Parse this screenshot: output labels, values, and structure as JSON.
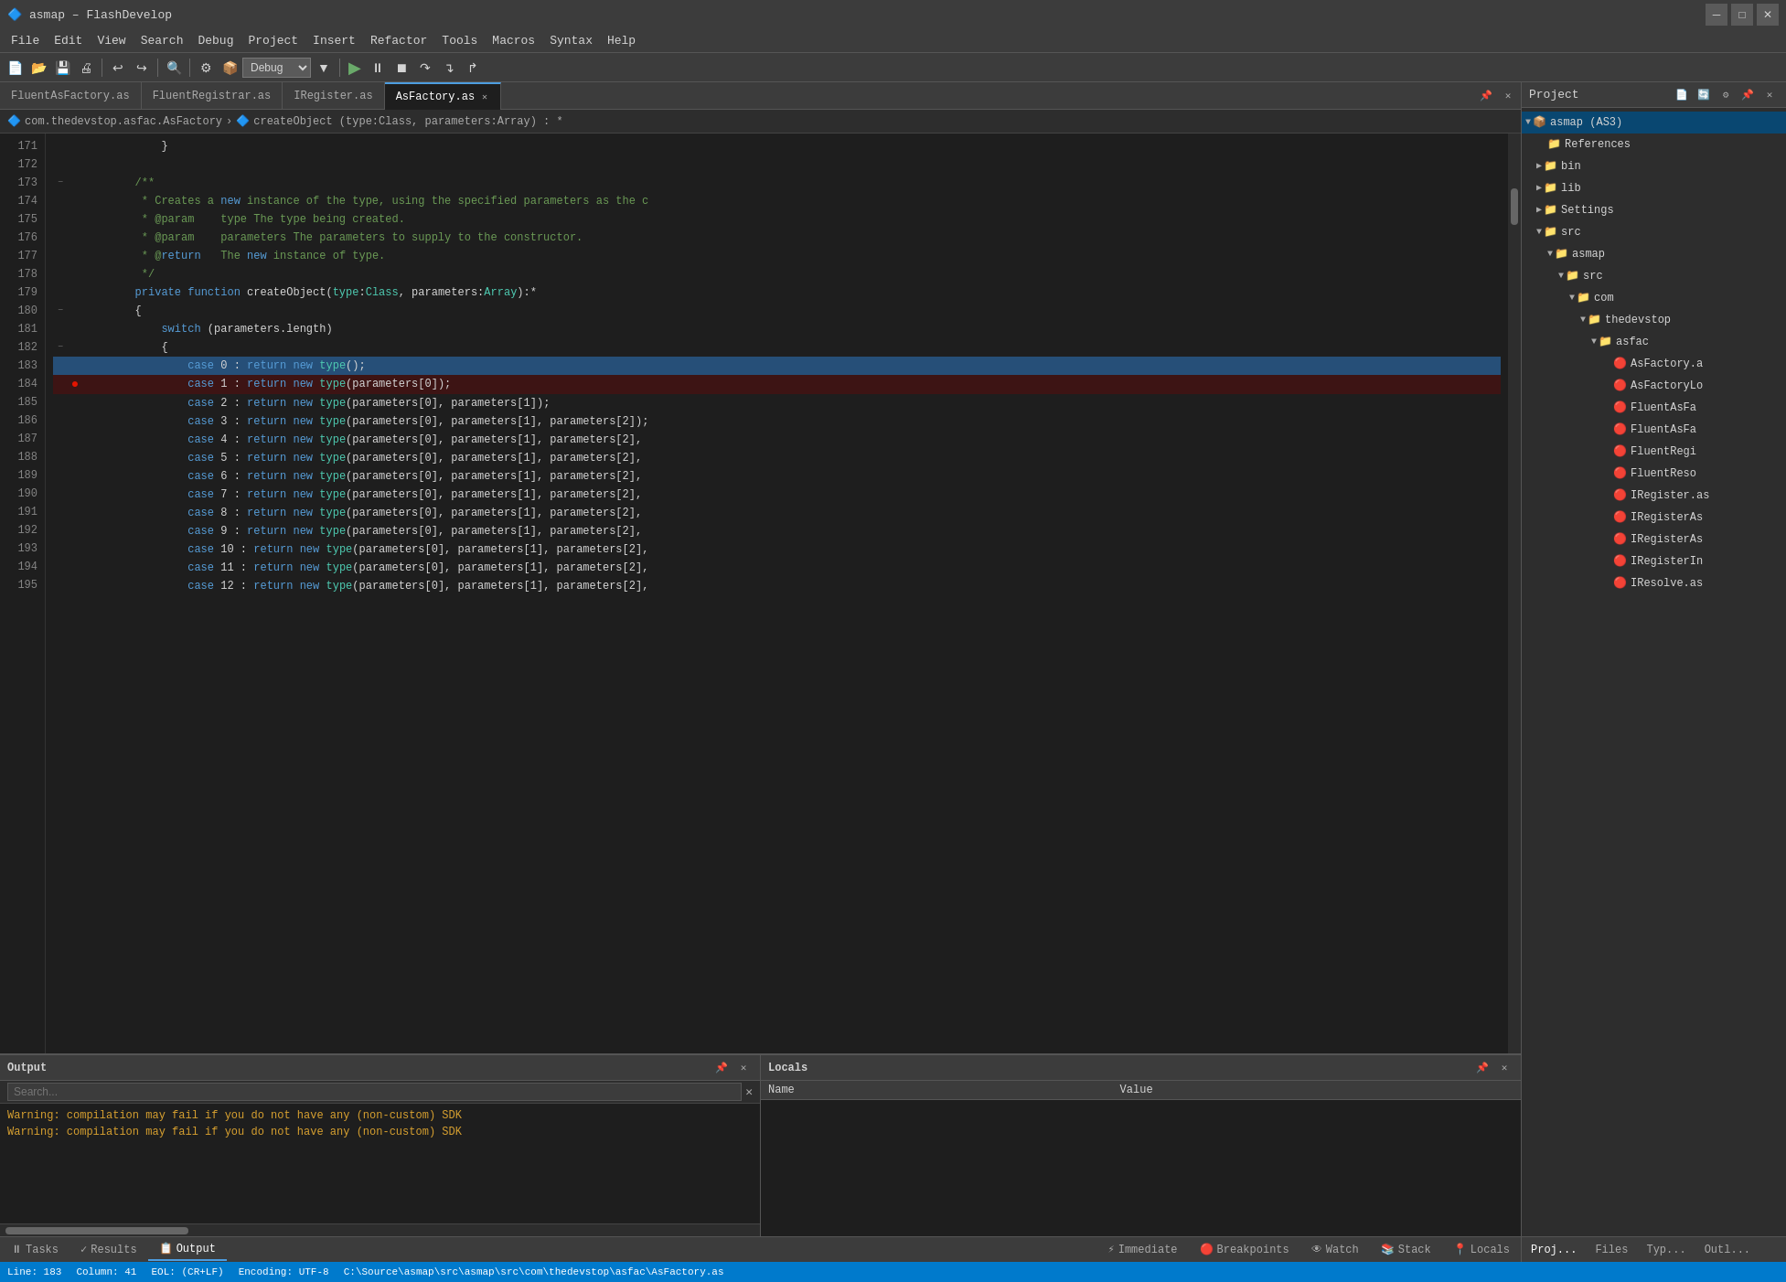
{
  "titleBar": {
    "icon": "🔷",
    "title": "asmap – FlashDevelop"
  },
  "menuBar": {
    "items": [
      "File",
      "Edit",
      "View",
      "Search",
      "Debug",
      "Project",
      "Insert",
      "Refactor",
      "Tools",
      "Macros",
      "Syntax",
      "Help"
    ]
  },
  "toolbar": {
    "debugLabel": "Debug",
    "runLabel": "▶"
  },
  "tabs": [
    {
      "label": "FluentAsFactory.as",
      "active": false
    },
    {
      "label": "FluentRegistrar.as",
      "active": false
    },
    {
      "label": "IRegister.as",
      "active": false
    },
    {
      "label": "AsFactory.as",
      "active": true
    }
  ],
  "breadcrumb": {
    "path": "com.thedevstop.asfac.AsFactory",
    "method": "createObject (type:Class, parameters:Array) : *"
  },
  "codeLines": [
    {
      "num": 171,
      "fold": "",
      "bp": "",
      "code": "            }",
      "highlight": ""
    },
    {
      "num": 172,
      "fold": "",
      "bp": "",
      "code": "",
      "highlight": ""
    },
    {
      "num": 173,
      "fold": "−",
      "bp": "",
      "code": "        /**",
      "highlight": ""
    },
    {
      "num": 174,
      "fold": "",
      "bp": "",
      "code": "         * Creates a new instance of the type, using the specified parameters as the c",
      "highlight": ""
    },
    {
      "num": 175,
      "fold": "",
      "bp": "",
      "code": "         * @param    type The type being created.",
      "highlight": ""
    },
    {
      "num": 176,
      "fold": "",
      "bp": "",
      "code": "         * @param    parameters The parameters to supply to the constructor.",
      "highlight": ""
    },
    {
      "num": 177,
      "fold": "",
      "bp": "",
      "code": "         * @return   The new instance of type.",
      "highlight": ""
    },
    {
      "num": 178,
      "fold": "",
      "bp": "",
      "code": "         */",
      "highlight": ""
    },
    {
      "num": 179,
      "fold": "",
      "bp": "",
      "code": "        private function createObject(type:Class, parameters:Array):*",
      "highlight": ""
    },
    {
      "num": 180,
      "fold": "−",
      "bp": "",
      "code": "        {",
      "highlight": ""
    },
    {
      "num": 181,
      "fold": "",
      "bp": "",
      "code": "            switch (parameters.length)",
      "highlight": ""
    },
    {
      "num": 182,
      "fold": "−",
      "bp": "",
      "code": "            {",
      "highlight": ""
    },
    {
      "num": 183,
      "fold": "",
      "bp": "",
      "code": "                case 0 : return new type();",
      "highlight": "blue"
    },
    {
      "num": 184,
      "fold": "",
      "bp": "●",
      "code": "                case 1 : return new type(parameters[0]);",
      "highlight": "red"
    },
    {
      "num": 185,
      "fold": "",
      "bp": "",
      "code": "                case 2 : return new type(parameters[0], parameters[1]);",
      "highlight": ""
    },
    {
      "num": 186,
      "fold": "",
      "bp": "",
      "code": "                case 3 : return new type(parameters[0], parameters[1], parameters[2]);",
      "highlight": ""
    },
    {
      "num": 187,
      "fold": "",
      "bp": "",
      "code": "                case 4 : return new type(parameters[0], parameters[1], parameters[2],",
      "highlight": ""
    },
    {
      "num": 188,
      "fold": "",
      "bp": "",
      "code": "                case 5 : return new type(parameters[0], parameters[1], parameters[2],",
      "highlight": ""
    },
    {
      "num": 189,
      "fold": "",
      "bp": "",
      "code": "                case 6 : return new type(parameters[0], parameters[1], parameters[2],",
      "highlight": ""
    },
    {
      "num": 190,
      "fold": "",
      "bp": "",
      "code": "                case 7 : return new type(parameters[0], parameters[1], parameters[2],",
      "highlight": ""
    },
    {
      "num": 191,
      "fold": "",
      "bp": "",
      "code": "                case 8 : return new type(parameters[0], parameters[1], parameters[2],",
      "highlight": ""
    },
    {
      "num": 192,
      "fold": "",
      "bp": "",
      "code": "                case 9 : return new type(parameters[0], parameters[1], parameters[2],",
      "highlight": ""
    },
    {
      "num": 193,
      "fold": "",
      "bp": "",
      "code": "                case 10 : return new type(parameters[0], parameters[1], parameters[2],",
      "highlight": ""
    },
    {
      "num": 194,
      "fold": "",
      "bp": "",
      "code": "                case 11 : return new type(parameters[0], parameters[1], parameters[2],",
      "highlight": ""
    },
    {
      "num": 195,
      "fold": "",
      "bp": "",
      "code": "                case 12 : return new type(parameters[0], parameters[1], parameters[2],",
      "highlight": ""
    }
  ],
  "rightPanel": {
    "title": "Project",
    "tree": [
      {
        "indent": 0,
        "icon": "📦",
        "label": "asmap (AS3)",
        "expand": "▼",
        "selected": true
      },
      {
        "indent": 1,
        "icon": "📁",
        "label": "References",
        "expand": ""
      },
      {
        "indent": 1,
        "icon": "📁",
        "label": "bin",
        "expand": "▶"
      },
      {
        "indent": 1,
        "icon": "📁",
        "label": "lib",
        "expand": "▶"
      },
      {
        "indent": 1,
        "icon": "📁",
        "label": "Settings",
        "expand": "▶"
      },
      {
        "indent": 1,
        "icon": "📁",
        "label": "src",
        "expand": "▼"
      },
      {
        "indent": 2,
        "icon": "📁",
        "label": "asmap",
        "expand": "▼"
      },
      {
        "indent": 3,
        "icon": "📁",
        "label": "src",
        "expand": "▼"
      },
      {
        "indent": 4,
        "icon": "📁",
        "label": "com",
        "expand": "▼"
      },
      {
        "indent": 5,
        "icon": "📁",
        "label": "thedevstop",
        "expand": "▼"
      },
      {
        "indent": 6,
        "icon": "📁",
        "label": "asfac",
        "expand": "▼"
      },
      {
        "indent": 7,
        "icon": "📄",
        "label": "AsFactory.a",
        "expand": "",
        "file": true
      },
      {
        "indent": 7,
        "icon": "📄",
        "label": "AsFactoryLo",
        "expand": "",
        "file": true
      },
      {
        "indent": 7,
        "icon": "📄",
        "label": "FluentAsFa",
        "expand": "",
        "file": true
      },
      {
        "indent": 7,
        "icon": "📄",
        "label": "FluentAsFa",
        "expand": "",
        "file": true
      },
      {
        "indent": 7,
        "icon": "📄",
        "label": "FluentRegi",
        "expand": "",
        "file": true
      },
      {
        "indent": 7,
        "icon": "📄",
        "label": "FluentReso",
        "expand": "",
        "file": true
      },
      {
        "indent": 7,
        "icon": "📄",
        "label": "IRegister.as",
        "expand": "",
        "file": true
      },
      {
        "indent": 7,
        "icon": "📄",
        "label": "IRegisterAs",
        "expand": "",
        "file": true
      },
      {
        "indent": 7,
        "icon": "📄",
        "label": "IRegisterAs",
        "expand": "",
        "file": true
      },
      {
        "indent": 7,
        "icon": "📄",
        "label": "IRegisterIn",
        "expand": "",
        "file": true
      },
      {
        "indent": 7,
        "icon": "📄",
        "label": "IResolve.as",
        "expand": "",
        "file": true
      }
    ],
    "bottomTabs": [
      "Proj...",
      "Files",
      "Typ...",
      "Outl..."
    ]
  },
  "outputPanel": {
    "title": "Output",
    "searchPlaceholder": "Search...",
    "warnings": [
      "Warning: compilation may fail if you do not have any (non-custom) SDK",
      "Warning: compilation may fail if you do not have any (non-custom) SDK"
    ]
  },
  "localsPanel": {
    "title": "Locals",
    "columns": [
      "Name",
      "Value"
    ],
    "rows": []
  },
  "bottomTabs": {
    "items": [
      {
        "icon": "⏸",
        "label": "Tasks",
        "active": false
      },
      {
        "icon": "✓",
        "label": "Results",
        "active": false
      },
      {
        "icon": "📋",
        "label": "Output",
        "active": true
      }
    ],
    "rightItems": [
      {
        "icon": "⚡",
        "label": "Immediate"
      },
      {
        "icon": "🔴",
        "label": "Breakpoints"
      },
      {
        "icon": "👁",
        "label": "Watch"
      },
      {
        "icon": "📚",
        "label": "Stack"
      },
      {
        "icon": "📍",
        "label": "Locals"
      }
    ]
  },
  "statusBar": {
    "line": "Line: 183",
    "column": "Column: 41",
    "eol": "EOL: (CR+LF)",
    "encoding": "Encoding: UTF-8",
    "path": "C:\\Source\\asmap\\src\\asmap\\src\\com\\thedevstop\\asfac\\AsFactory.as"
  }
}
